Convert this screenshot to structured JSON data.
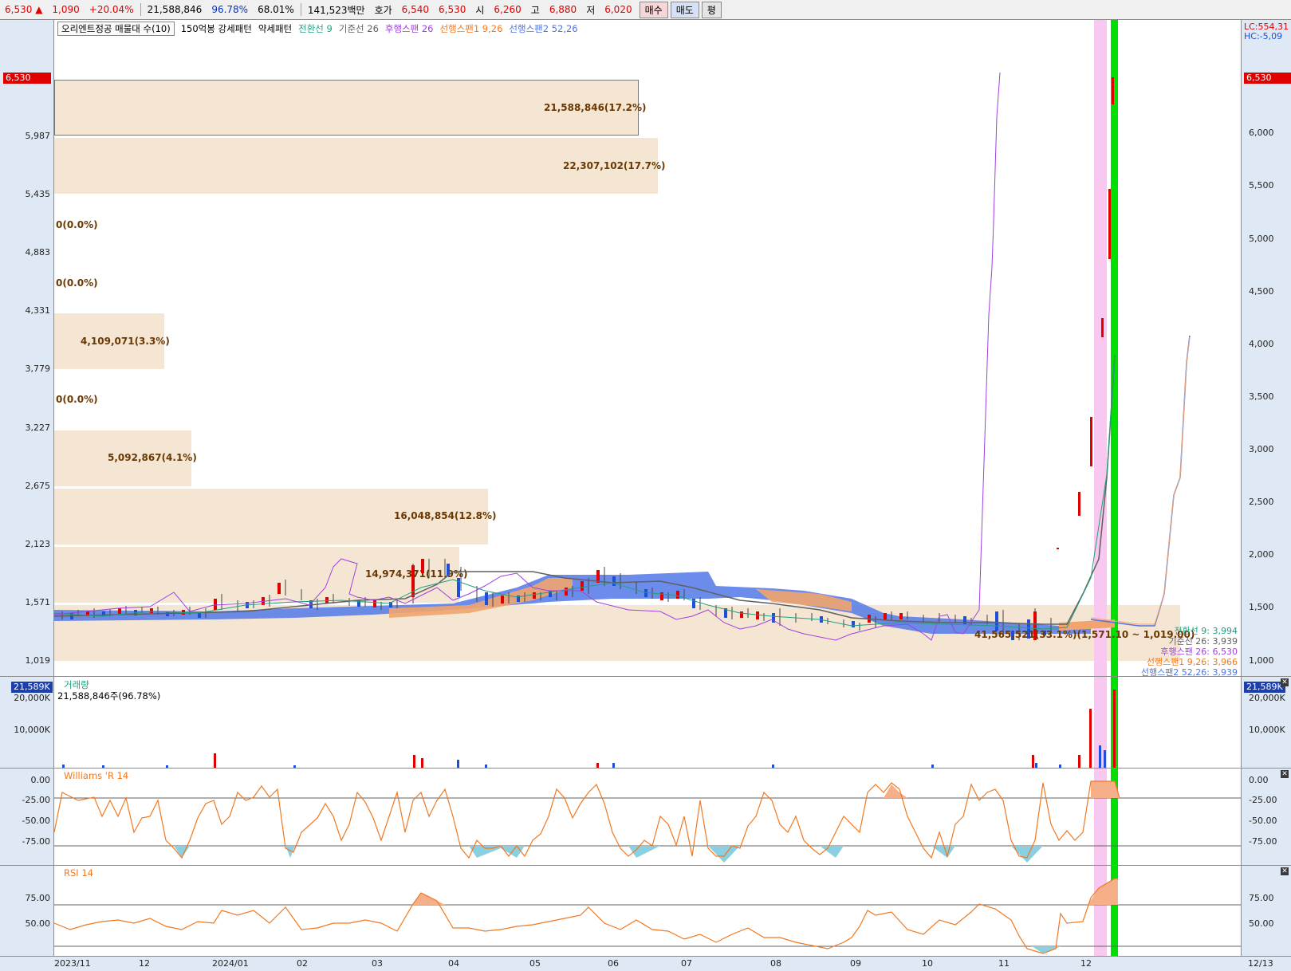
{
  "topbar": {
    "price": "6,530",
    "arrow": "▲",
    "change": "1,090",
    "change_pct": "+20.04%",
    "volume": "21,588,846",
    "vol_ratio": "96.78%",
    "ratio2": "68.01%",
    "amount": "141,523백만",
    "hoga_label": "호가",
    "hoga_ask": "6,540",
    "hoga_bid": "6,530",
    "open_label": "시",
    "open": "6,260",
    "high_label": "고",
    "high": "6,880",
    "low_label": "저",
    "low": "6,020",
    "buy_btn": "매수",
    "sell_btn": "매도",
    "flat_btn": "평"
  },
  "legend": {
    "indicator_box": "오리엔트정공 매물대 수(10)",
    "item1": "150억봉 강세패턴",
    "item2": "약세패턴",
    "tenkan": "전환선 9",
    "kijun": "기준선 26",
    "chikou": "후행스팬 26",
    "senkou1": "선행스팬1 9,26",
    "senkou2": "선행스팬2 52,26"
  },
  "right_top": {
    "lc": "LC:554,31",
    "hc": "HC:-5,09"
  },
  "price_axis_left": [
    "5,987",
    "5,435",
    "4,883",
    "4,331",
    "3,779",
    "3,227",
    "2,675",
    "2,123",
    "1,571",
    "1,019"
  ],
  "price_axis_right": [
    "6,000",
    "5,500",
    "5,000",
    "4,500",
    "4,000",
    "3,500",
    "3,000",
    "2,500",
    "2,000",
    "1,500",
    "1,000"
  ],
  "current_price_tag": "6,530",
  "volume_profile": [
    {
      "label": "21,588,846(17.2%)",
      "pct": 17.2
    },
    {
      "label": "22,307,102(17.7%)",
      "pct": 17.7
    },
    {
      "label": "0(0.0%)",
      "pct": 0
    },
    {
      "label": "0(0.0%)",
      "pct": 0
    },
    {
      "label": "4,109,071(3.3%)",
      "pct": 3.3
    },
    {
      "label": "0(0.0%)",
      "pct": 0
    },
    {
      "label": "5,092,867(4.1%)",
      "pct": 4.1
    },
    {
      "label": "16,048,854(12.8%)",
      "pct": 12.8
    },
    {
      "label": "14,974,371(11.9%)",
      "pct": 11.9
    },
    {
      "label": "41,565,521(33.1%)(1,571.10 ~ 1,019.00)",
      "pct": 33.1
    }
  ],
  "ichimoku_values": {
    "tenkan": "전환선 9: 3,994",
    "kijun": "기준선 26: 3,939",
    "chikou": "후행스팬 26: 6,530",
    "senkou1": "선행스팬1 9,26: 3,966",
    "senkou2": "선행스팬2 52,26: 3,939"
  },
  "volume_pane": {
    "title": "거래량",
    "value": "21,588,846주(96.78%)",
    "tag": "21,589K",
    "ticks": [
      "20,000K",
      "10,000K"
    ]
  },
  "williams_pane": {
    "title": "Williams 'R 14",
    "ticks": [
      "0.00",
      "-25.00",
      "-50.00",
      "-75.00"
    ]
  },
  "rsi_pane": {
    "title": "RSI 14",
    "ticks": [
      "75.00",
      "50.00"
    ]
  },
  "x_axis": [
    "2023/11",
    "12",
    "2024/01",
    "02",
    "03",
    "04",
    "05",
    "06",
    "07",
    "08",
    "09",
    "10",
    "11",
    "12",
    "12/13"
  ],
  "colors": {
    "up": "#e00000",
    "down": "#1d4fd8",
    "profile": "#f5e6d3",
    "cloud_bear": "#5b7fe8",
    "cloud_bull": "#f2a46e",
    "chikou": "#a040e0",
    "highlight_pink": "#f9c8f0",
    "highlight_green": "#00e000",
    "indicator_line": "#f07820"
  }
}
